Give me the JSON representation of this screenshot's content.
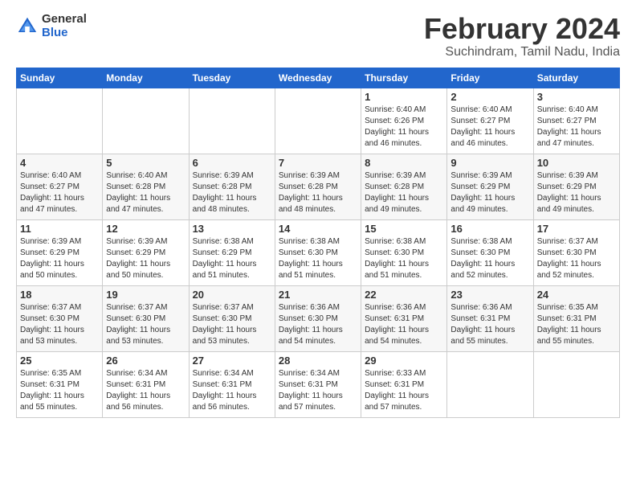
{
  "logo": {
    "general": "General",
    "blue": "Blue"
  },
  "title": "February 2024",
  "location": "Suchindram, Tamil Nadu, India",
  "headers": [
    "Sunday",
    "Monday",
    "Tuesday",
    "Wednesday",
    "Thursday",
    "Friday",
    "Saturday"
  ],
  "weeks": [
    [
      {
        "day": "",
        "info": ""
      },
      {
        "day": "",
        "info": ""
      },
      {
        "day": "",
        "info": ""
      },
      {
        "day": "",
        "info": ""
      },
      {
        "day": "1",
        "info": "Sunrise: 6:40 AM\nSunset: 6:26 PM\nDaylight: 11 hours\nand 46 minutes."
      },
      {
        "day": "2",
        "info": "Sunrise: 6:40 AM\nSunset: 6:27 PM\nDaylight: 11 hours\nand 46 minutes."
      },
      {
        "day": "3",
        "info": "Sunrise: 6:40 AM\nSunset: 6:27 PM\nDaylight: 11 hours\nand 47 minutes."
      }
    ],
    [
      {
        "day": "4",
        "info": "Sunrise: 6:40 AM\nSunset: 6:27 PM\nDaylight: 11 hours\nand 47 minutes."
      },
      {
        "day": "5",
        "info": "Sunrise: 6:40 AM\nSunset: 6:28 PM\nDaylight: 11 hours\nand 47 minutes."
      },
      {
        "day": "6",
        "info": "Sunrise: 6:39 AM\nSunset: 6:28 PM\nDaylight: 11 hours\nand 48 minutes."
      },
      {
        "day": "7",
        "info": "Sunrise: 6:39 AM\nSunset: 6:28 PM\nDaylight: 11 hours\nand 48 minutes."
      },
      {
        "day": "8",
        "info": "Sunrise: 6:39 AM\nSunset: 6:28 PM\nDaylight: 11 hours\nand 49 minutes."
      },
      {
        "day": "9",
        "info": "Sunrise: 6:39 AM\nSunset: 6:29 PM\nDaylight: 11 hours\nand 49 minutes."
      },
      {
        "day": "10",
        "info": "Sunrise: 6:39 AM\nSunset: 6:29 PM\nDaylight: 11 hours\nand 49 minutes."
      }
    ],
    [
      {
        "day": "11",
        "info": "Sunrise: 6:39 AM\nSunset: 6:29 PM\nDaylight: 11 hours\nand 50 minutes."
      },
      {
        "day": "12",
        "info": "Sunrise: 6:39 AM\nSunset: 6:29 PM\nDaylight: 11 hours\nand 50 minutes."
      },
      {
        "day": "13",
        "info": "Sunrise: 6:38 AM\nSunset: 6:29 PM\nDaylight: 11 hours\nand 51 minutes."
      },
      {
        "day": "14",
        "info": "Sunrise: 6:38 AM\nSunset: 6:30 PM\nDaylight: 11 hours\nand 51 minutes."
      },
      {
        "day": "15",
        "info": "Sunrise: 6:38 AM\nSunset: 6:30 PM\nDaylight: 11 hours\nand 51 minutes."
      },
      {
        "day": "16",
        "info": "Sunrise: 6:38 AM\nSunset: 6:30 PM\nDaylight: 11 hours\nand 52 minutes."
      },
      {
        "day": "17",
        "info": "Sunrise: 6:37 AM\nSunset: 6:30 PM\nDaylight: 11 hours\nand 52 minutes."
      }
    ],
    [
      {
        "day": "18",
        "info": "Sunrise: 6:37 AM\nSunset: 6:30 PM\nDaylight: 11 hours\nand 53 minutes."
      },
      {
        "day": "19",
        "info": "Sunrise: 6:37 AM\nSunset: 6:30 PM\nDaylight: 11 hours\nand 53 minutes."
      },
      {
        "day": "20",
        "info": "Sunrise: 6:37 AM\nSunset: 6:30 PM\nDaylight: 11 hours\nand 53 minutes."
      },
      {
        "day": "21",
        "info": "Sunrise: 6:36 AM\nSunset: 6:30 PM\nDaylight: 11 hours\nand 54 minutes."
      },
      {
        "day": "22",
        "info": "Sunrise: 6:36 AM\nSunset: 6:31 PM\nDaylight: 11 hours\nand 54 minutes."
      },
      {
        "day": "23",
        "info": "Sunrise: 6:36 AM\nSunset: 6:31 PM\nDaylight: 11 hours\nand 55 minutes."
      },
      {
        "day": "24",
        "info": "Sunrise: 6:35 AM\nSunset: 6:31 PM\nDaylight: 11 hours\nand 55 minutes."
      }
    ],
    [
      {
        "day": "25",
        "info": "Sunrise: 6:35 AM\nSunset: 6:31 PM\nDaylight: 11 hours\nand 55 minutes."
      },
      {
        "day": "26",
        "info": "Sunrise: 6:34 AM\nSunset: 6:31 PM\nDaylight: 11 hours\nand 56 minutes."
      },
      {
        "day": "27",
        "info": "Sunrise: 6:34 AM\nSunset: 6:31 PM\nDaylight: 11 hours\nand 56 minutes."
      },
      {
        "day": "28",
        "info": "Sunrise: 6:34 AM\nSunset: 6:31 PM\nDaylight: 11 hours\nand 57 minutes."
      },
      {
        "day": "29",
        "info": "Sunrise: 6:33 AM\nSunset: 6:31 PM\nDaylight: 11 hours\nand 57 minutes."
      },
      {
        "day": "",
        "info": ""
      },
      {
        "day": "",
        "info": ""
      }
    ]
  ]
}
